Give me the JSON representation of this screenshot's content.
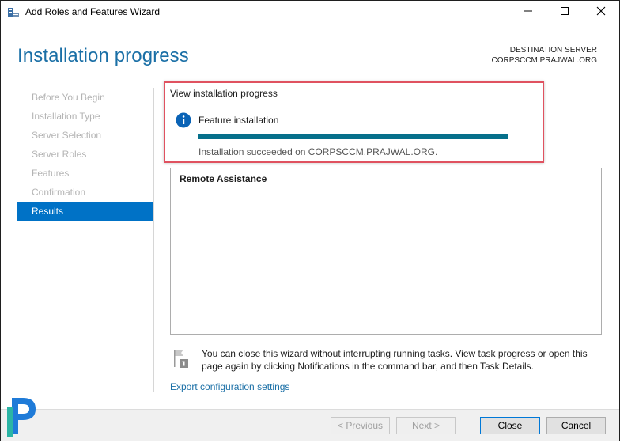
{
  "window": {
    "title": "Add Roles and Features Wizard",
    "controls": {
      "minimize_icon": "minimize-icon",
      "maximize_icon": "maximize-icon",
      "close_icon": "close-icon"
    }
  },
  "header": {
    "page_title": "Installation progress",
    "destination_label": "DESTINATION SERVER",
    "destination_server": "CORPSCCM.PRAJWAL.ORG"
  },
  "nav": {
    "items": [
      {
        "label": "Before You Begin",
        "state": "disabled"
      },
      {
        "label": "Installation Type",
        "state": "disabled"
      },
      {
        "label": "Server Selection",
        "state": "disabled"
      },
      {
        "label": "Server Roles",
        "state": "disabled"
      },
      {
        "label": "Features",
        "state": "disabled"
      },
      {
        "label": "Confirmation",
        "state": "disabled"
      },
      {
        "label": "Results",
        "state": "active"
      }
    ]
  },
  "progress": {
    "heading": "View installation progress",
    "feature_label": "Feature installation",
    "percent": 100,
    "status": "Installation succeeded on CORPSCCM.PRAJWAL.ORG.",
    "icon": "info-icon"
  },
  "results": {
    "title": "Remote Assistance"
  },
  "note": {
    "icon": "notification-flag-icon",
    "text": "You can close this wizard without interrupting running tasks. View task progress or open this page again by clicking Notifications in the command bar, and then Task Details."
  },
  "export_link": "Export configuration settings",
  "buttons": {
    "previous": "< Previous",
    "next": "Next >",
    "close": "Close",
    "cancel": "Cancel"
  },
  "colors": {
    "accent": "#0072c6",
    "title_blue": "#1a6fa6",
    "progress": "#06708b",
    "highlight": "#e05260"
  }
}
